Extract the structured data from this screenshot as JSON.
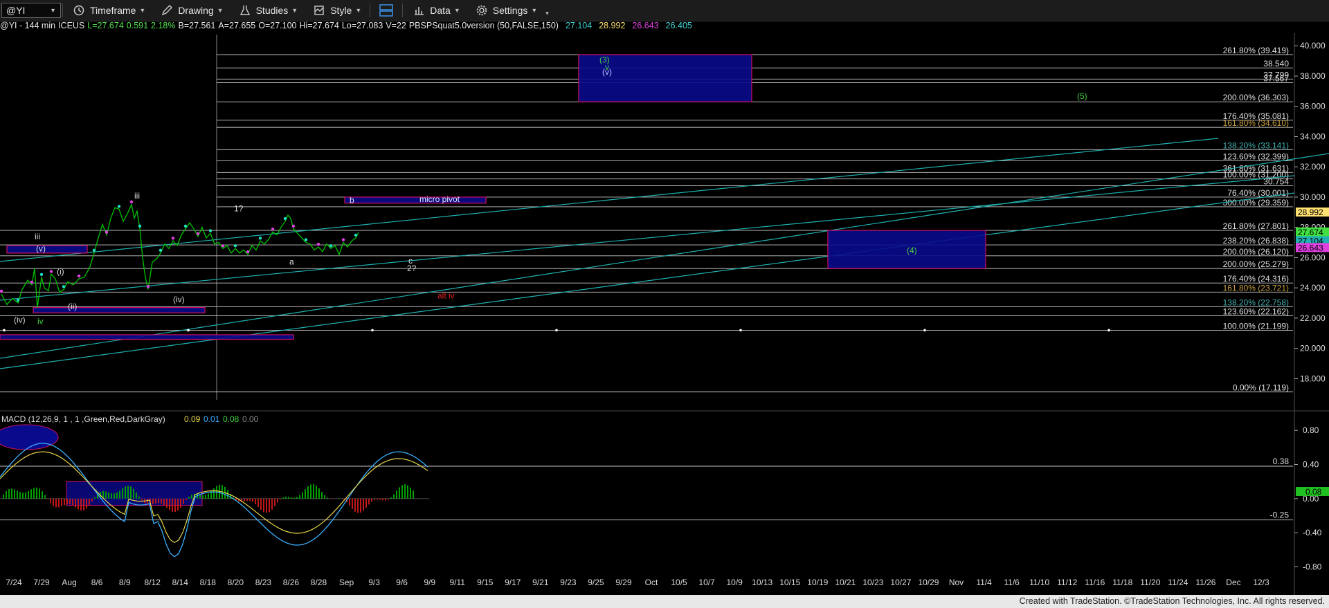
{
  "toolbar": {
    "symbol": "@YI",
    "timeframe": "Timeframe",
    "drawing": "Drawing",
    "studies": "Studies",
    "style": "Style",
    "data": "Data",
    "settings": "Settings"
  },
  "infobar": {
    "symbol": "@YI - 144 min",
    "exchange": "ICEUS",
    "last": "L=27.674",
    "change": "0.591",
    "change_pct": "2.18%",
    "bid": "B=27.561",
    "ask": "A=27.655",
    "open": "O=27.100",
    "high": "Hi=27.674",
    "low": "Lo=27.083",
    "volume": "V=22",
    "study": "PBSPSquat5.0version (50,FALSE,150)",
    "study_vals": [
      "27.104",
      "28.992",
      "26.643",
      "26.405"
    ]
  },
  "footer": "Created with TradeStation. ©TradeStation Technologies, Inc. All rights reserved.",
  "colors": {
    "price": "#00c400",
    "fib_text": "#d8d8d8",
    "box_fill": "#0a0a8c",
    "box_border": "#d01060",
    "trend": "#20b0b0",
    "macd": "#3ab0ff",
    "signal": "#e8d84a",
    "hist_pos": "#00a000",
    "hist_neg": "#c01818",
    "highlight": "#ffe070"
  },
  "chart_data": [
    {
      "type": "line",
      "name_label": "price",
      "x_labels": [
        "7/24",
        "7/29",
        "Aug",
        "8/6",
        "8/9",
        "8/12",
        "8/14",
        "8/18",
        "8/20",
        "8/23",
        "8/26",
        "8/28",
        "Sep",
        "9/3",
        "9/6",
        "9/9",
        "9/11",
        "9/15",
        "9/17",
        "9/21",
        "9/23",
        "9/25",
        "9/29",
        "Oct",
        "10/5",
        "10/7",
        "10/9",
        "10/13",
        "10/15",
        "10/19",
        "10/21",
        "10/23",
        "10/27",
        "10/29",
        "Nov",
        "11/4",
        "11/6",
        "11/10",
        "11/12",
        "11/16",
        "11/18",
        "11/20",
        "11/24",
        "11/26",
        "Dec",
        "12/3"
      ],
      "ylim": [
        16.6,
        41.2
      ],
      "y_ticks": [
        18,
        20,
        22,
        24,
        26,
        28,
        30,
        32,
        34,
        36,
        38,
        40
      ],
      "tick_labels": [
        "18.000",
        "20.000",
        "22.000",
        "24.000",
        "26.000",
        "28.000",
        "30.000",
        "32.000",
        "34.000",
        "36.000",
        "38.000",
        "40.000"
      ],
      "close": [
        [
          0,
          23.6
        ],
        [
          8,
          22.9
        ],
        [
          16,
          23.3
        ],
        [
          24,
          23.0
        ],
        [
          30,
          23.9
        ],
        [
          38,
          24.5
        ],
        [
          44,
          24.2
        ],
        [
          48,
          25.3
        ],
        [
          52,
          22.7
        ],
        [
          58,
          24.7
        ],
        [
          62,
          24.0
        ],
        [
          68,
          23.8
        ],
        [
          72,
          24.9
        ],
        [
          78,
          24.6
        ],
        [
          84,
          23.7
        ],
        [
          90,
          23.9
        ],
        [
          96,
          24.4
        ],
        [
          104,
          24.2
        ],
        [
          112,
          24.6
        ],
        [
          120,
          24.7
        ],
        [
          128,
          25.4
        ],
        [
          134,
          26.3
        ],
        [
          140,
          27.3
        ],
        [
          146,
          28.2
        ],
        [
          152,
          27.5
        ],
        [
          158,
          28.6
        ],
        [
          164,
          29.3
        ],
        [
          170,
          29.2
        ],
        [
          176,
          28.4
        ],
        [
          182,
          28.9
        ],
        [
          188,
          29.5
        ],
        [
          192,
          28.6
        ],
        [
          196,
          29.1
        ],
        [
          200,
          27.9
        ],
        [
          204,
          26.0
        ],
        [
          208,
          24.7
        ],
        [
          212,
          23.9
        ],
        [
          218,
          25.7
        ],
        [
          224,
          25.9
        ],
        [
          230,
          26.3
        ],
        [
          236,
          26.9
        ],
        [
          242,
          26.6
        ],
        [
          248,
          27.1
        ],
        [
          254,
          26.8
        ],
        [
          260,
          27.5
        ],
        [
          266,
          27.9
        ],
        [
          272,
          28.3
        ],
        [
          278,
          27.9
        ],
        [
          284,
          27.4
        ],
        [
          290,
          28.0
        ],
        [
          296,
          27.3
        ],
        [
          302,
          27.6
        ],
        [
          308,
          26.9
        ],
        [
          314,
          27.0
        ],
        [
          320,
          26.6
        ],
        [
          326,
          26.8
        ],
        [
          332,
          26.3
        ],
        [
          338,
          26.6
        ],
        [
          344,
          26.3
        ],
        [
          350,
          26.5
        ],
        [
          356,
          26.2
        ],
        [
          362,
          26.8
        ],
        [
          368,
          26.5
        ],
        [
          374,
          27.1
        ],
        [
          380,
          26.9
        ],
        [
          386,
          27.2
        ],
        [
          392,
          27.7
        ],
        [
          398,
          27.5
        ],
        [
          404,
          28.0
        ],
        [
          410,
          28.4
        ],
        [
          414,
          28.8
        ],
        [
          418,
          28.6
        ],
        [
          422,
          27.9
        ],
        [
          428,
          27.6
        ],
        [
          434,
          27.3
        ],
        [
          440,
          27.0
        ],
        [
          446,
          26.9
        ],
        [
          452,
          26.5
        ],
        [
          458,
          26.7
        ],
        [
          464,
          26.4
        ],
        [
          470,
          26.9
        ],
        [
          476,
          26.6
        ],
        [
          482,
          26.8
        ],
        [
          488,
          26.2
        ],
        [
          494,
          27.0
        ],
        [
          500,
          26.7
        ],
        [
          506,
          27.1
        ],
        [
          512,
          27.3
        ],
        [
          516,
          27.67
        ]
      ],
      "fib_levels": [
        {
          "label": "261.80% (39.419)",
          "y": 39.42
        },
        {
          "label": "38.540",
          "y": 38.54
        },
        {
          "label": "37.799",
          "y": 37.8
        },
        {
          "label": "37.567",
          "y": 37.57
        },
        {
          "label": "200.00% (36.303)",
          "y": 36.3
        },
        {
          "label": "176.40% (35.081)",
          "y": 35.08
        },
        {
          "label": "161.80% (34.610)",
          "y": 34.61
        },
        {
          "label": "138.20% (33.141)",
          "y": 33.14
        },
        {
          "label": "123.60% (32.399)",
          "y": 32.4
        },
        {
          "label": "361.80% (31.631)",
          "y": 31.63
        },
        {
          "label": "100.00% (31.200)",
          "y": 31.2
        },
        {
          "label": "30.754",
          "y": 30.75
        },
        {
          "label": "76.40% (30.001)",
          "y": 30.0
        },
        {
          "label": "300.00% (29.359)",
          "y": 29.36
        },
        {
          "label": "261.80% (27.801)",
          "y": 27.8
        },
        {
          "label": "238.20% (26.838)",
          "y": 26.84
        },
        {
          "label": "200.00% (26.120)",
          "y": 26.12
        },
        {
          "label": "200.00% (25.279)",
          "y": 25.28
        },
        {
          "label": "176.40% (24.316)",
          "y": 24.32
        },
        {
          "label": "161.80% (23.721)",
          "y": 23.72
        },
        {
          "label": "138.20% (22.758)",
          "y": 22.76
        },
        {
          "label": "123.60% (22.162)",
          "y": 22.16
        },
        {
          "label": "100.00% (21.199)",
          "y": 21.2
        },
        {
          "label": "0.00% (17.119)",
          "y": 17.12
        }
      ],
      "last_price_tags": [
        "28.992",
        "27.674",
        "27.104",
        "26.643"
      ],
      "annotations": [
        "(3)",
        "v",
        "(v)",
        "(5)",
        "(4)",
        "micro pivot",
        "b",
        "1?",
        "a",
        "c",
        "2?",
        "alt iv",
        "iii",
        "(v)",
        "(i)",
        "(ii)",
        "(iv)",
        "iv",
        "(iv)",
        "iii"
      ]
    },
    {
      "type": "line",
      "title": "MACD (12,26,9, 1 , 1 ,Green,Red,DarkGray)",
      "values": [
        "0.09",
        "0.01",
        "0.08",
        "0.00"
      ],
      "ylim": [
        -0.95,
        0.98
      ],
      "y_ticks": [
        0.8,
        0.4,
        0.0,
        -0.4,
        -0.8
      ],
      "tick_labels": [
        "0.80",
        "0.40",
        "0.00",
        "-0.40",
        "-0.80"
      ],
      "levels": [
        {
          "label": "0.38",
          "y": 0.38
        },
        {
          "label": "-0.25",
          "y": -0.25
        }
      ],
      "last_tag": "0.08"
    }
  ]
}
